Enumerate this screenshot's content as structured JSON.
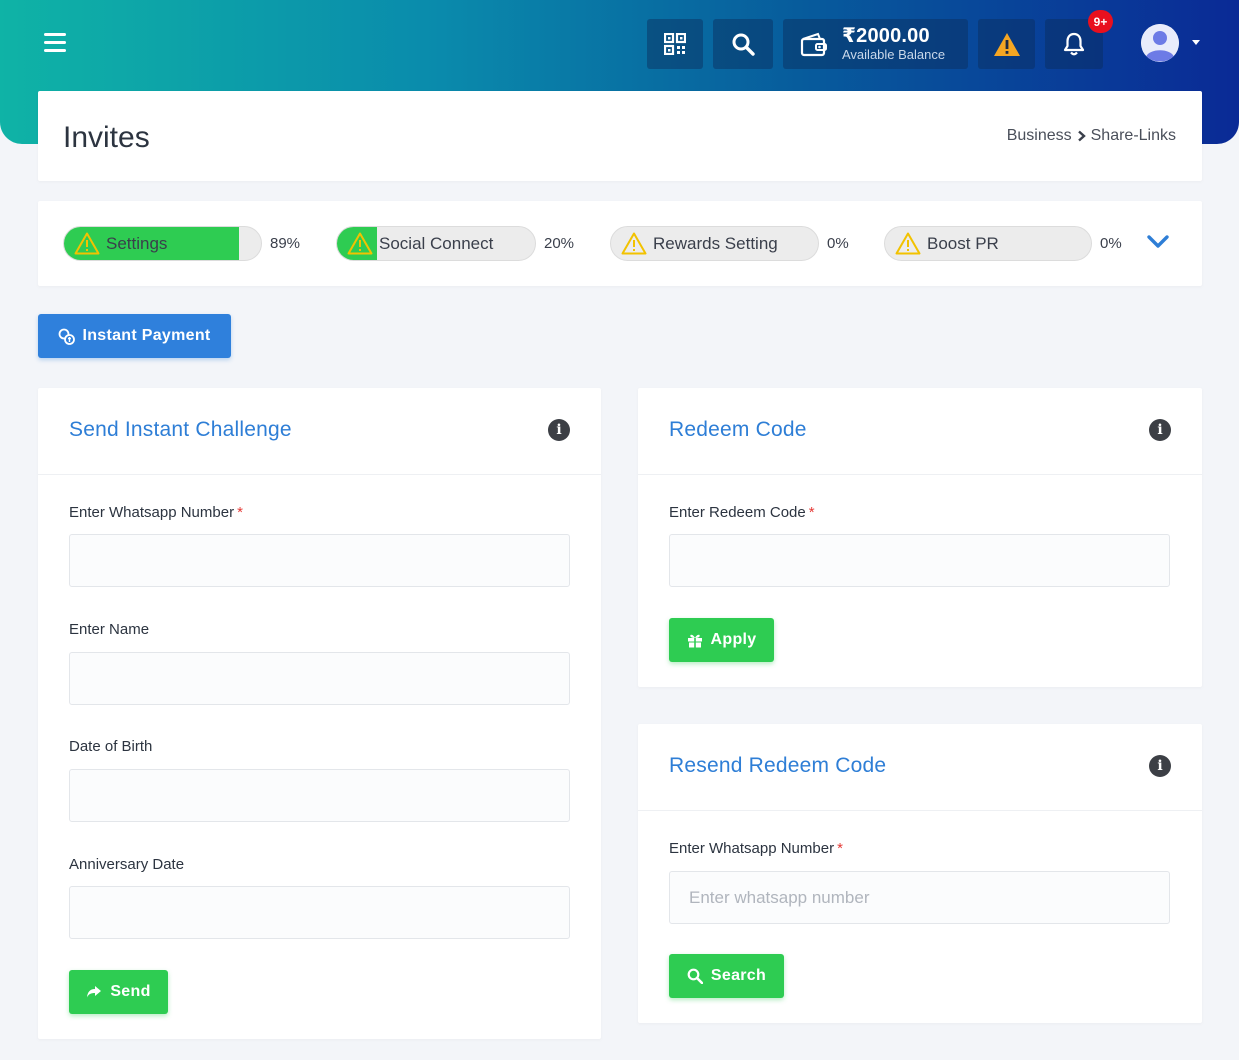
{
  "header": {
    "wallet_amount": "₹2000.00",
    "wallet_label": "Available Balance",
    "notification_badge": "9+",
    "icons": [
      "menu-icon",
      "qr-code-icon",
      "search-icon",
      "wallet-icon",
      "warning-icon",
      "bell-icon",
      "avatar-icon"
    ]
  },
  "page": {
    "title": "Invites",
    "breadcrumb": {
      "parent": "Business",
      "current": "Share-Links"
    }
  },
  "progress": [
    {
      "label": "Settings",
      "percent": "89%",
      "value": 0.89,
      "icon": "warning-icon"
    },
    {
      "label": "Social Connect",
      "percent": "20%",
      "value": 0.2,
      "icon": "warning-icon"
    },
    {
      "label": "Rewards Setting",
      "percent": "0%",
      "value": 0,
      "icon": "warning-icon"
    },
    {
      "label": "Boost PR",
      "percent": "0%",
      "value": 0,
      "icon": "warning-icon"
    }
  ],
  "instant_payment": {
    "label": "Instant Payment"
  },
  "challenge": {
    "title": "Send Instant Challenge",
    "whatsapp_label": "Enter Whatsapp Number",
    "name_label": "Enter Name",
    "dob_label": "Date of Birth",
    "anniversary_label": "Anniversary Date",
    "send_label": "Send"
  },
  "redeem": {
    "title": "Redeem Code",
    "code_label": "Enter Redeem Code",
    "apply_label": "Apply"
  },
  "resend": {
    "title": "Resend Redeem Code",
    "whatsapp_label": "Enter Whatsapp Number",
    "whatsapp_placeholder": "Enter whatsapp number",
    "search_label": "Search"
  },
  "required_mark": "*",
  "colors": {
    "accent": "#2e7ed6",
    "success": "#2ecc52",
    "primary_button": "#2f80dc",
    "warning": "#f5a623",
    "danger": "#e8101e"
  }
}
